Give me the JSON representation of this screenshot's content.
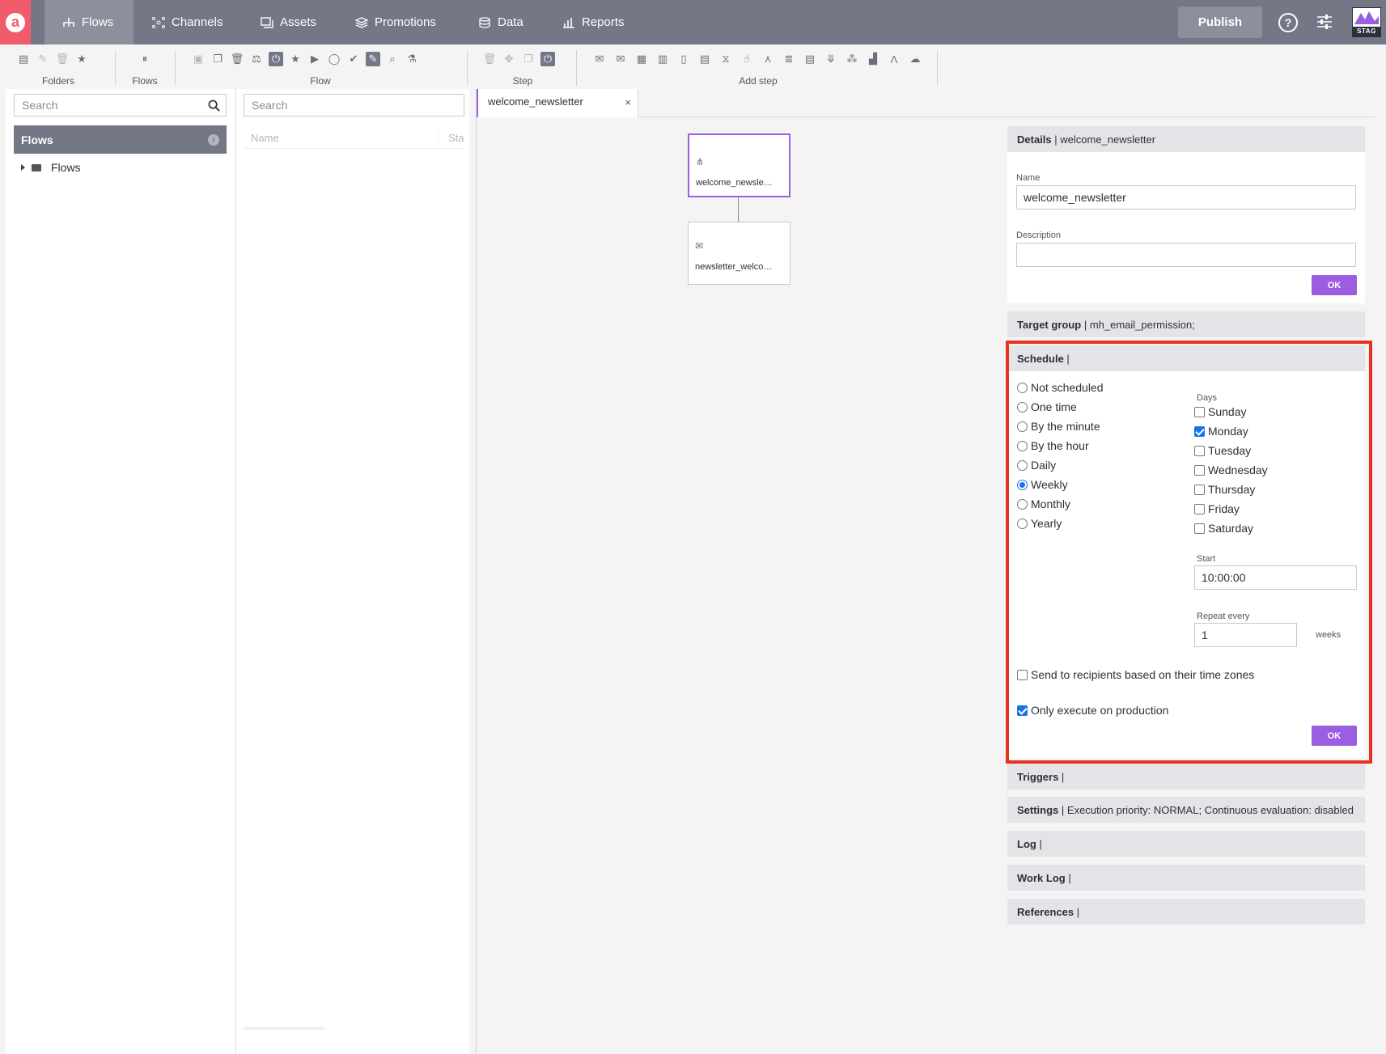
{
  "nav": {
    "logo": "a",
    "tabs": [
      {
        "label": "Flows",
        "icon": "flow-icon"
      },
      {
        "label": "Channels",
        "icon": "channels-icon"
      },
      {
        "label": "Assets",
        "icon": "assets-icon"
      },
      {
        "label": "Promotions",
        "icon": "promotions-icon"
      },
      {
        "label": "Data",
        "icon": "database-icon"
      },
      {
        "label": "Reports",
        "icon": "reports-icon"
      }
    ],
    "publish": "Publish",
    "help": "?",
    "env": "STAG"
  },
  "toolbar": {
    "groups": [
      "Folders",
      "Flows",
      "Flow",
      "Step",
      "Add step"
    ]
  },
  "left": {
    "search_placeholder": "Search",
    "header": "Flows",
    "info": "i",
    "tree_item": "Flows"
  },
  "middle": {
    "search_placeholder": "Search",
    "col_name": "Name",
    "col_status": "Sta"
  },
  "editor": {
    "tab": "welcome_newsletter",
    "close": "×",
    "nodes": [
      {
        "label": "welcome_newsle…"
      },
      {
        "label": "newsletter_welco…"
      }
    ]
  },
  "details": {
    "title": "Details",
    "title_value": "welcome_newsletter",
    "name_label": "Name",
    "name_value": "welcome_newsletter",
    "description_label": "Description",
    "description_value": "",
    "ok": "OK"
  },
  "target": {
    "title": "Target group",
    "value": "mh_email_permission;"
  },
  "schedule": {
    "title": "Schedule",
    "options": [
      "Not scheduled",
      "One time",
      "By the minute",
      "By the hour",
      "Daily",
      "Weekly",
      "Monthly",
      "Yearly"
    ],
    "selected": "Weekly",
    "days_label": "Days",
    "days": [
      "Sunday",
      "Monday",
      "Tuesday",
      "Wednesday",
      "Thursday",
      "Friday",
      "Saturday"
    ],
    "days_checked": [
      "Monday"
    ],
    "start_label": "Start",
    "start_value": "10:00:00",
    "repeat_label": "Repeat every",
    "repeat_value": "1",
    "repeat_unit": "weeks",
    "timezone_label": "Send to recipients based on their time zones",
    "timezone_checked": false,
    "production_label": "Only execute on production",
    "production_checked": true,
    "ok": "OK"
  },
  "sections": {
    "triggers": "Triggers",
    "settings": "Settings",
    "settings_value": "Execution priority: NORMAL; Continuous evaluation: disabled",
    "log": "Log",
    "worklog": "Work Log",
    "references": "References"
  },
  "colors": {
    "accent": "#9b5ee0",
    "nav": "#737786",
    "highlight": "#e8321e",
    "logo": "#f15b6c"
  }
}
